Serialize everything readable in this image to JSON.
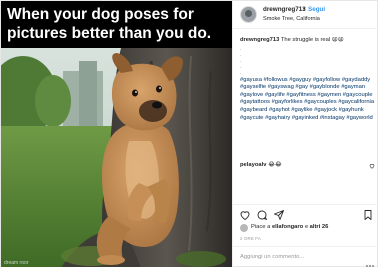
{
  "meme": {
    "line1": "When your dog poses for",
    "line2": "pictures better than you do."
  },
  "header": {
    "username": "drewngreg713",
    "separator": "•",
    "follow_label": "Segui",
    "location": "Smoke Tree, California"
  },
  "caption": {
    "username": "drewngreg713",
    "text": "The struggle is real 😩😩",
    "dots": [
      ".",
      ".",
      ".",
      ".",
      "."
    ],
    "hashtags": "#gayusa #followus #gayguy #gayfollow #gaydaddy #gayselfie #gayswag #gay #gayblonde #gayman #gaylove #gaylife #gayfitness #gaymen #gaycouple #gaytattoos #gayforlikes #gaycouples #gaycalifornia #gaybeard #gayhot #gaylike #gayjock #gayhunk #gaycute #gayhairy #gayinked #instagay #gayworld"
  },
  "comment": {
    "username": "pelayoalv",
    "text": "😂😂"
  },
  "likes": {
    "prefix": "Piace a ",
    "user": "ellafongaro",
    "middle": " e ",
    "others": "altri 26"
  },
  "timestamp": "2 ORE FA",
  "add_comment": {
    "placeholder": "Aggiungi un commento..."
  },
  "photo": {
    "credit": "dream roor"
  },
  "colors": {
    "link_blue": "#3897f0",
    "hashtag": "#003569",
    "meme_bg": "#000000",
    "meme_text": "#ffffff"
  },
  "icons": [
    "heart-icon",
    "comment-icon",
    "share-icon",
    "bookmark-icon",
    "more-icon"
  ]
}
